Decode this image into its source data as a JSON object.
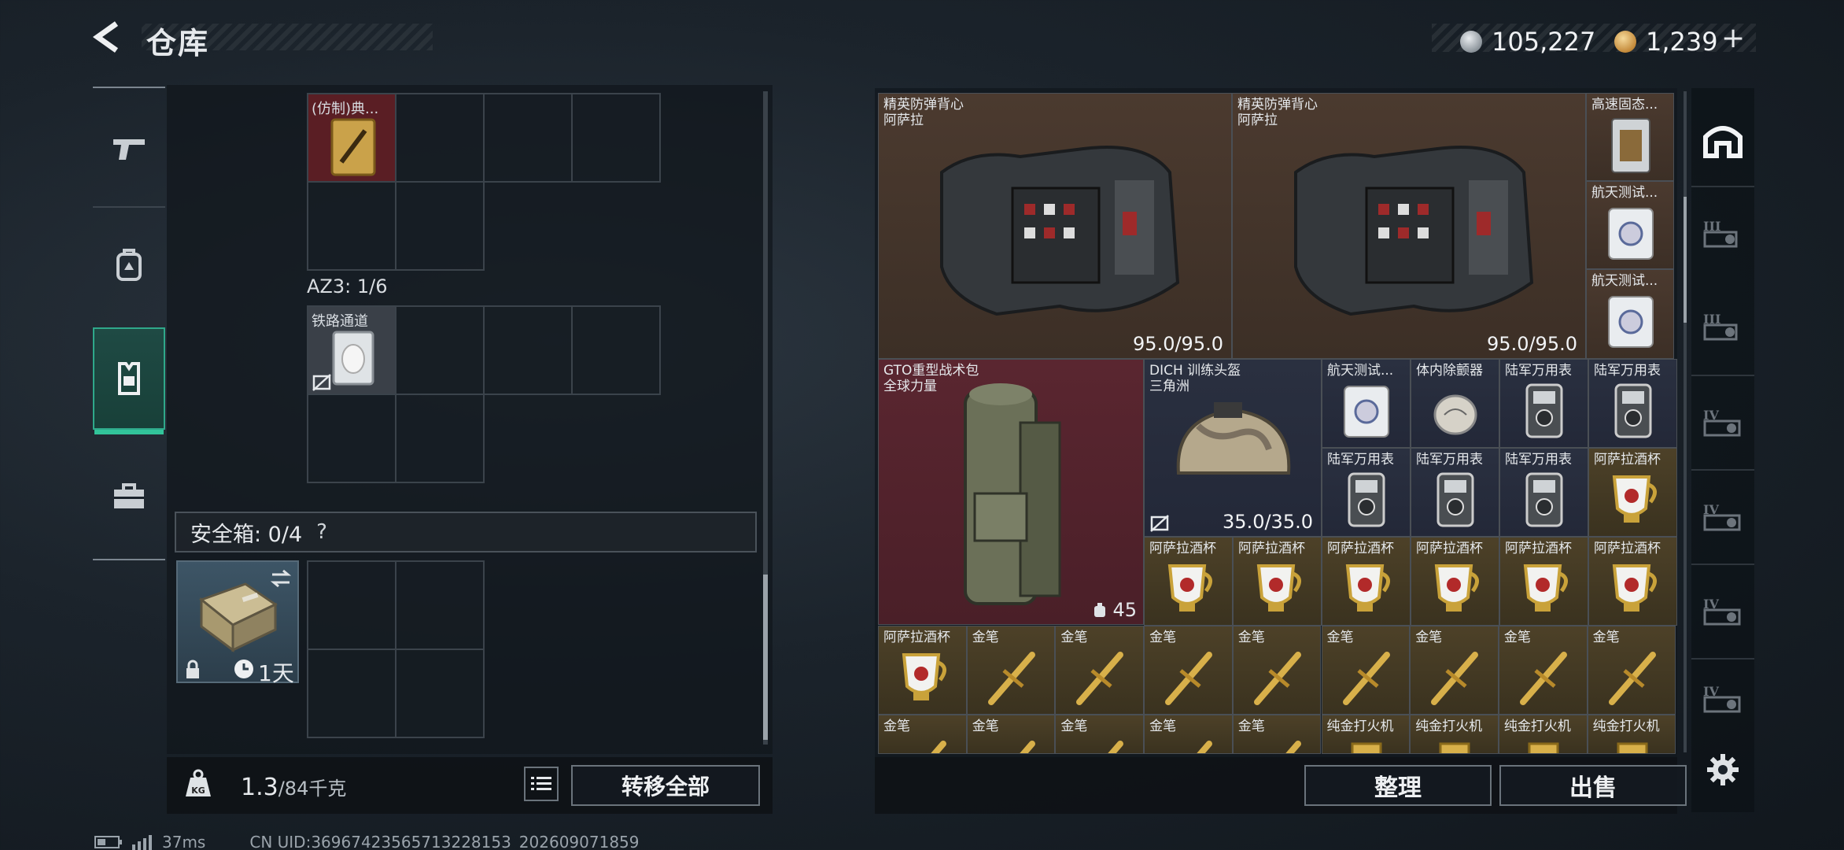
{
  "header": {
    "title": "仓库",
    "currency": [
      {
        "icon": "silver-coin-icon",
        "value": "105,227"
      },
      {
        "icon": "gold-coin-icon",
        "value": "1,239"
      }
    ],
    "add_symbol": "+"
  },
  "left_nav": [
    "gun-icon",
    "backpack-icon",
    "vest-icon",
    "briefcase-icon"
  ],
  "left_panel": {
    "item_top": {
      "name": "(仿制)典..."
    },
    "section_az3": "AZ3: 1/6",
    "item_railway": {
      "name": "铁路通道"
    },
    "safe_box": {
      "label": "安全箱: 0/4",
      "help": "?"
    },
    "safe_item": {
      "timer": "1天"
    },
    "weight": {
      "current": "1.3",
      "max": "/84千克"
    },
    "transfer_all": "转移全部"
  },
  "right_panel": {
    "vest1": {
      "name": "精英防弹背心",
      "sub": "阿萨拉",
      "durability": "95.0/95.0"
    },
    "vest2": {
      "name": "精英防弹背心",
      "sub": "阿萨拉",
      "durability": "95.0/95.0"
    },
    "small_top": [
      {
        "name": "高速固态..."
      },
      {
        "name": "航天测试..."
      },
      {
        "name": "航天测试..."
      }
    ],
    "backpack": {
      "name": "GTO重型战术包",
      "sub": "全球力量",
      "count": "45"
    },
    "helmet": {
      "name": "DICH 训练头盔",
      "sub": "三角洲",
      "durability": "35.0/35.0"
    },
    "grid_items": [
      {
        "name": "航天测试...",
        "color": "navy"
      },
      {
        "name": "体内除颤器",
        "color": "navy"
      },
      {
        "name": "陆军万用表",
        "color": "navy"
      },
      {
        "name": "陆军万用表",
        "color": "navy"
      },
      {
        "name": "陆军万用表",
        "color": "navy"
      },
      {
        "name": "陆军万用表",
        "color": "navy"
      },
      {
        "name": "陆军万用表",
        "color": "navy"
      },
      {
        "name": "阿萨拉酒杯",
        "color": "gold"
      },
      {
        "name": "阿萨拉酒杯",
        "color": "gold"
      },
      {
        "name": "阿萨拉酒杯",
        "color": "gold"
      },
      {
        "name": "阿萨拉酒杯",
        "color": "gold"
      },
      {
        "name": "阿萨拉酒杯",
        "color": "gold"
      },
      {
        "name": "阿萨拉酒杯",
        "color": "gold"
      },
      {
        "name": "阿萨拉酒杯",
        "color": "gold"
      },
      {
        "name": "阿萨拉酒杯",
        "color": "gold"
      },
      {
        "name": "金笔",
        "color": "gold"
      },
      {
        "name": "金笔",
        "color": "gold"
      },
      {
        "name": "金笔",
        "color": "gold"
      },
      {
        "name": "金笔",
        "color": "gold"
      },
      {
        "name": "金笔",
        "color": "gold"
      },
      {
        "name": "金笔",
        "color": "gold"
      },
      {
        "name": "金笔",
        "color": "gold"
      },
      {
        "name": "金笔",
        "color": "gold"
      },
      {
        "name": "金笔",
        "color": "gold"
      },
      {
        "name": "金笔",
        "color": "gold"
      },
      {
        "name": "金笔",
        "color": "gold"
      },
      {
        "name": "金笔",
        "color": "gold"
      },
      {
        "name": "金笔",
        "color": "gold"
      },
      {
        "name": "纯金打火机",
        "color": "gold"
      },
      {
        "name": "纯金打火机",
        "color": "gold"
      },
      {
        "name": "纯金打火机",
        "color": "gold"
      },
      {
        "name": "纯金打火机",
        "color": "gold"
      }
    ],
    "sort_button": "整理",
    "sell_button": "出售"
  },
  "right_tabs": [
    "home-icon",
    "III",
    "III",
    "IV",
    "IV",
    "IV",
    "IV"
  ],
  "status_bar": {
    "ping": "37ms",
    "uid": "CN UID:3696742356571322815​3_202609071859"
  }
}
